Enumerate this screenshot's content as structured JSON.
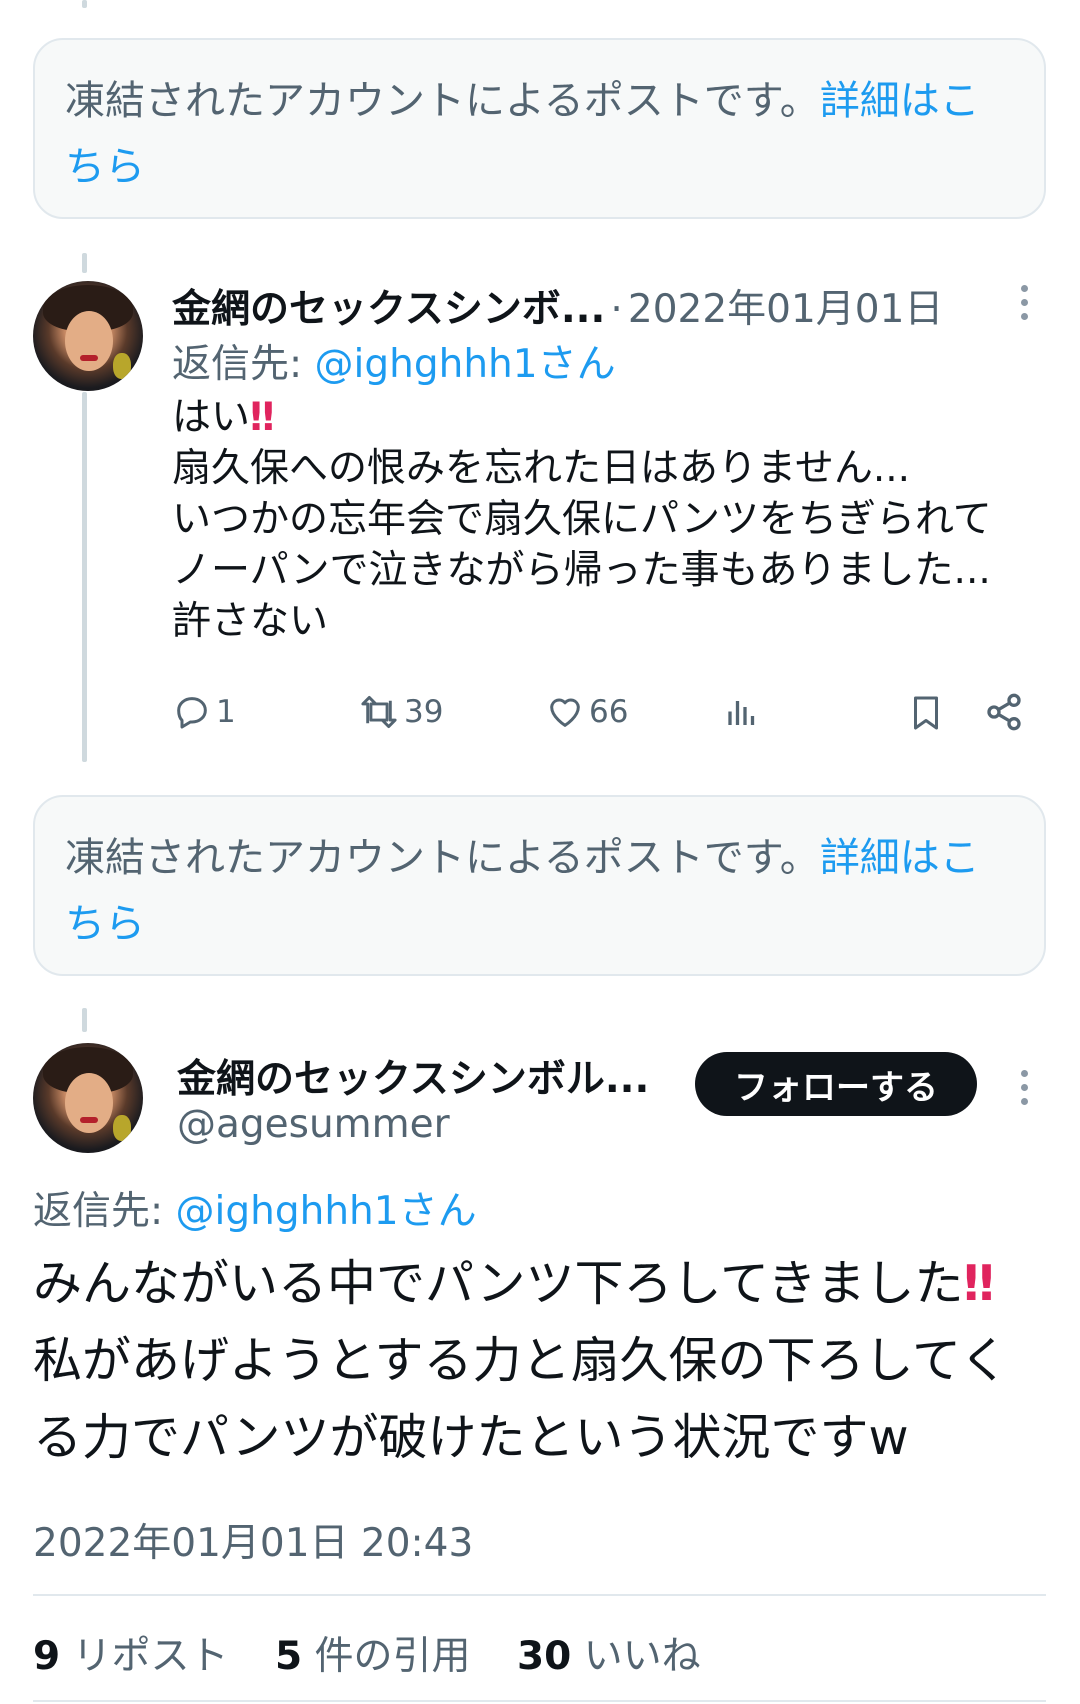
{
  "notice": {
    "text": "凍結されたアカウントによるポストです。",
    "link": "詳細はこ",
    "link_cont": "ちら"
  },
  "reply_tweet": {
    "author_name": "金網のセックスシンボ...",
    "separator": "·",
    "date": "2022年01月01日",
    "reply_prefix": "返信先: ",
    "reply_to": "@ighghhh1さん",
    "text": "はい\n扇久保への恨みを忘れた日はありません...\nいつかの忘年会で扇久保にパンツをちぎられて\nノーパンで泣きながら帰った事もありました...\n許さない",
    "emoji": "‼",
    "reply_count": "1",
    "retweet_count": "39",
    "like_count": "66"
  },
  "main_tweet": {
    "author_name": "金網のセックスシンボル...",
    "handle": "@agesummer",
    "follow_label": "フォローする",
    "reply_prefix": "返信先: ",
    "reply_to": "@ighghhh1さん",
    "text_line1": "みんながいる中でパンツ下ろしてきました",
    "emoji": "‼",
    "text_rest": "私があげようとする力と扇久保の下ろしてく\nる力でパンツが破けたという状況ですw",
    "timestamp": "2022年01月01日 20:43",
    "stats": {
      "reposts_count": "9",
      "reposts_label": "リポスト",
      "quotes_count": "5",
      "quotes_label": "件の引用",
      "likes_count": "30",
      "likes_label": "いいね"
    }
  },
  "colors": {
    "accent": "#1d9bf0",
    "text": "#0f1419",
    "muted": "#536471",
    "alert_emoji": "#e0245e"
  }
}
